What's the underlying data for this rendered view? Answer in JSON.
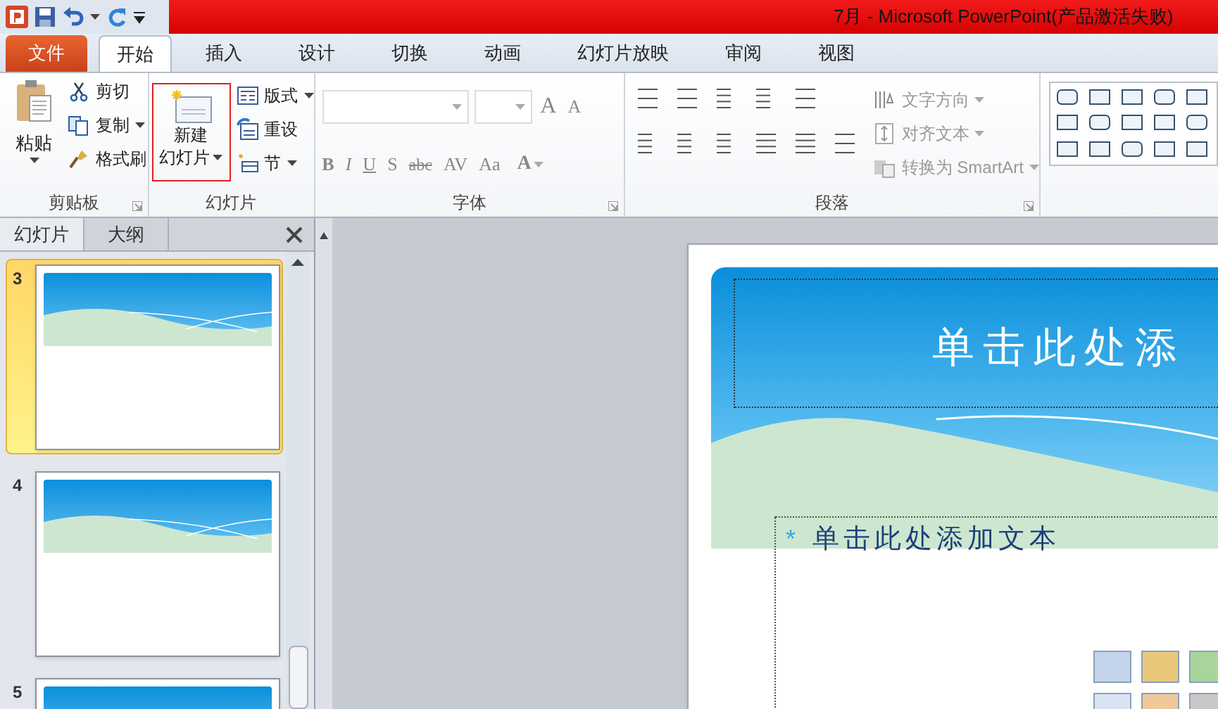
{
  "title_bar": {
    "title": "7月  -  Microsoft PowerPoint(产品激活失败)"
  },
  "ribbon_tabs": [
    {
      "label": "文件",
      "kind": "file",
      "selected": false
    },
    {
      "label": "开始",
      "kind": "tab",
      "selected": true
    },
    {
      "label": "插入",
      "kind": "tab",
      "selected": false
    },
    {
      "label": "设计",
      "kind": "tab",
      "selected": false
    },
    {
      "label": "切换",
      "kind": "tab",
      "selected": false
    },
    {
      "label": "动画",
      "kind": "tab",
      "selected": false
    },
    {
      "label": "幻灯片放映",
      "kind": "tab",
      "selected": false
    },
    {
      "label": "审阅",
      "kind": "tab",
      "selected": false
    },
    {
      "label": "视图",
      "kind": "tab",
      "selected": false
    }
  ],
  "clipboard": {
    "label": "剪贴板",
    "paste": "粘贴",
    "items": [
      "剪切",
      "复制",
      "格式刷"
    ]
  },
  "slides_group": {
    "label": "幻灯片",
    "new_slide": [
      "新建",
      "幻灯片"
    ],
    "items": [
      "版式",
      "重设",
      "节"
    ]
  },
  "font_group": {
    "label": "字体",
    "size_buttons": [
      "A",
      "A"
    ],
    "style_buttons": [
      "B",
      "I",
      "U",
      "S",
      "abc",
      "AV",
      "Aa"
    ],
    "color_button": "A"
  },
  "paragraph_group": {
    "label": "段落",
    "items": [
      "文字方向",
      "对齐文本",
      "转换为 SmartArt"
    ]
  },
  "pane_tabs": [
    {
      "label": "幻灯片",
      "selected": true
    },
    {
      "label": "大纲",
      "selected": false
    }
  ],
  "thumbnails": [
    {
      "number": "3",
      "selected": true
    },
    {
      "number": "4",
      "selected": false
    },
    {
      "number": "5",
      "selected": false
    }
  ],
  "slide": {
    "title": "单击此处添",
    "bullet": "*",
    "body": "单击此处添加文本"
  }
}
